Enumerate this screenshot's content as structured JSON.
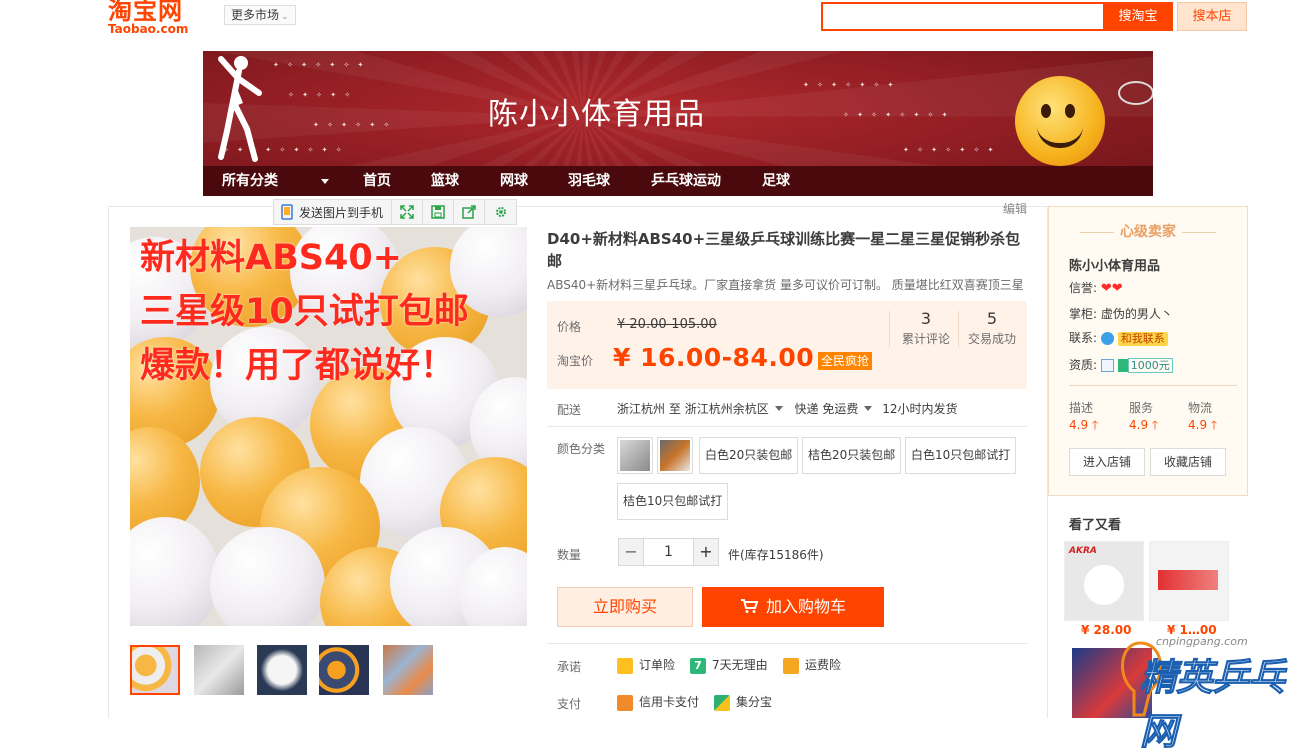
{
  "header": {
    "logo_cn": "淘宝网",
    "logo_en": "Taobao.com",
    "more_market": "更多市场",
    "search_button": "搜淘宝",
    "search_shop_button": "搜本店",
    "search_placeholder": ""
  },
  "banner": {
    "shop_title": "陈小小体育用品",
    "nav": [
      "所有分类",
      "首页",
      "篮球",
      "网球",
      "羽毛球",
      "乒乓球运动",
      "足球"
    ]
  },
  "image_toolbar": {
    "send_to_phone": "发送图片到手机",
    "tools": [
      "fullscreen-icon",
      "save-icon",
      "share-icon",
      "settings-icon"
    ]
  },
  "edit_link": "编辑",
  "main_image": {
    "overlay_lines": [
      "新材料ABS40+",
      "三星级10只试打包邮",
      "爆款！用了都说好！"
    ]
  },
  "thumbnails": [
    "thumb-1",
    "thumb-2",
    "thumb-3",
    "thumb-4",
    "thumb-5"
  ],
  "product": {
    "title": "D40+新材料ABS40+三星级乒乓球训练比赛一星二星三星促销秒杀包邮",
    "subtitle": "ABS40+新材料三星乒乓球。厂家直接拿货 量多可议价可订制。 质量堪比红双喜赛顶三星",
    "price_label": "价格",
    "original_price": "¥ 20.00-105.00",
    "taobao_price_label": "淘宝价",
    "taobao_price": "¥ 16.00-84.00",
    "promo_badge": "全民疯抢",
    "stats": [
      {
        "num": "3",
        "label": "累计评论"
      },
      {
        "num": "5",
        "label": "交易成功"
      }
    ],
    "delivery_label": "配送",
    "delivery_from": "浙江杭州",
    "delivery_to_word": "至",
    "delivery_to": "浙江杭州余杭区",
    "shipping": "快递 免运费",
    "ship_time": "12小时内发货",
    "color_label": "颜色分类",
    "skus": [
      "白色20只装包邮",
      "桔色20只装包邮",
      "白色10只包邮试打",
      "桔色10只包邮试打"
    ],
    "qty_label": "数量",
    "qty_minus": "−",
    "qty_value": "1",
    "qty_plus": "+",
    "stock": "件(库存15186件)",
    "buy_now": "立即购买",
    "add_cart": "加入购物车",
    "promise_label": "承诺",
    "promises": [
      "订单险",
      "7天无理由",
      "运费险"
    ],
    "pay_label": "支付",
    "payments": [
      "信用卡支付",
      "集分宝"
    ]
  },
  "seller": {
    "rank": "心级卖家",
    "name": "陈小小体育用品",
    "credit_label": "信誉:",
    "credit_hearts": "❤❤",
    "keeper_label": "掌柜:",
    "keeper": "虚伪的男人丶",
    "contact_label": "联系:",
    "contact_badge": "和我联系",
    "qual_label": "资质:",
    "deposit": "1000元",
    "scores": [
      {
        "label": "描述",
        "value": "4.9"
      },
      {
        "label": "服务",
        "value": "4.9"
      },
      {
        "label": "物流",
        "value": "4.9"
      }
    ],
    "enter_shop": "进入店铺",
    "fav_shop": "收藏店铺"
  },
  "also_viewed": {
    "title": "看了又看",
    "items": [
      {
        "price": "¥ 28.00"
      },
      {
        "price": "¥ 1…00"
      }
    ]
  },
  "watermark": {
    "url": "cnpingpang.com",
    "text": "精英乒乓网"
  },
  "colors": {
    "accent": "#ff4400",
    "banner_bg": "#8e1d22",
    "nav_bg": "#4a0a0d",
    "price_bg": "#fff2e8"
  }
}
